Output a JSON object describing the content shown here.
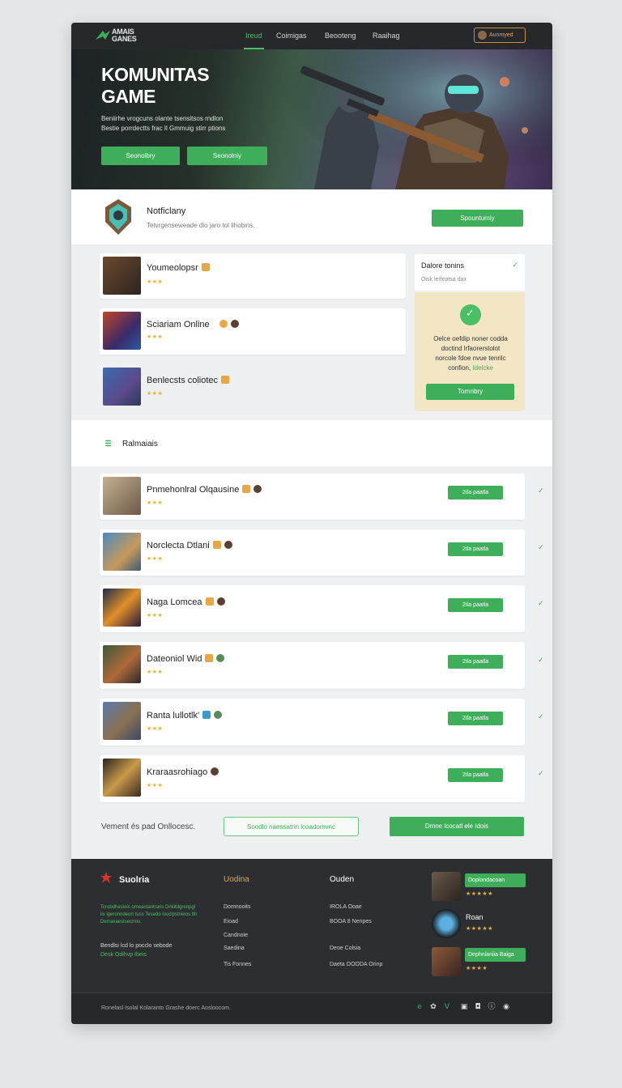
{
  "nav": {
    "brand": "AMAIS GANES",
    "links": [
      "Ireud",
      "Coimigas",
      "Beooteng",
      "Raaihag"
    ],
    "active_index": 0,
    "user_label": "Aunmyed"
  },
  "hero": {
    "title_line1": "KOMUNITAS",
    "title_line2": "GAME",
    "text_line1": "Beniirhe vrogcuns olante tsensitsos rndlon",
    "text_line2": "Bestie porrdectts frac Il Gmmuig stirr ptions",
    "btn1": "Seonolbry",
    "btn2": "Seonolniy"
  },
  "news": {
    "title": "Notficlany",
    "subtitle": "Tetvrgenseweade dio jaro tol lihobins.",
    "button": "Spountumiy",
    "cards": [
      {
        "name": "Youmeolopsr",
        "stars": "★★★"
      },
      {
        "name": "Sciariam Online",
        "stars": "★★★"
      },
      {
        "name": "Benlecsts coliotec",
        "stars": "★★★"
      }
    ]
  },
  "side_panel": {
    "title": "Dalore tonins",
    "subtitle": "Oisk lerfeatsa dax",
    "text_line1": "Oelce oefdip noner codda",
    "text_line2": "doctind lrfaorerstolot",
    "text_line3": "norcole fdoe nvue tenrilc",
    "text_prefix": "confion,",
    "text_highlight": "Idelcke",
    "button": "Tornnbry"
  },
  "ranking": {
    "title": "Ralmaiais",
    "rows": [
      {
        "name": "Pnmehonlral Olqausine",
        "stars": "★★★",
        "button": "2tla paatla"
      },
      {
        "name": "Norclecta Dtlani",
        "stars": "★★★",
        "button": "2tla paatla"
      },
      {
        "name": "Naga Lomcea",
        "stars": "★★★",
        "button": "2tla paatla"
      },
      {
        "name": "Dateoniol Wid",
        "stars": "★★★",
        "button": "2tla paatla"
      },
      {
        "name": "Ranta lullotlk'",
        "stars": "★★★",
        "button": "2tla paatla"
      },
      {
        "name": "Kraraasrohiago",
        "stars": "★★★",
        "button": "2tla paatla"
      }
    ]
  },
  "bottom": {
    "text": "Vement és pad Onllocesc.",
    "outline_button": "Soodlo naessatrin lcoadomvnc",
    "green_button": "Dmne lcocatl ele Idois"
  },
  "footer": {
    "brand": "Suolria",
    "desc": "Tcrobdhesiois omeantantraris Dnkitdgrenpgl lis lgeronndeort tuss Tesedo looclpstnieos Ith Derraeaestsecrnio.",
    "desc2_line1": "Bendlsi lcd lo pocclo sebode",
    "desc2_prefix": "Desk",
    "desc2_highlight": "Odihvp Ibeis",
    "col2": {
      "heading": "Uodina",
      "links": [
        "Domnooits",
        "Eioad",
        "Candnoie",
        "Saedina",
        "Tis Fonnes"
      ]
    },
    "col3": {
      "heading": "Ouden",
      "links": [
        "IROLA Ooae",
        "BOOA 8 Nenpes",
        "Deoe Colsia",
        "Daeta OOODA Orinp"
      ]
    },
    "people": [
      {
        "tag": "Doplondacoan",
        "stars": "★★★★★"
      },
      {
        "name": "Roan",
        "stars": "★★★★★"
      },
      {
        "tag": "Dephnlaniia Baiga",
        "stars": "★★★★"
      }
    ],
    "copyright": "Ronelasl Isolal Kolaranto Grashe doerc Aosloocom."
  },
  "colors": {
    "accent": "#3fae5a",
    "dark": "#2c2e31",
    "gold": "#e8b32a"
  }
}
